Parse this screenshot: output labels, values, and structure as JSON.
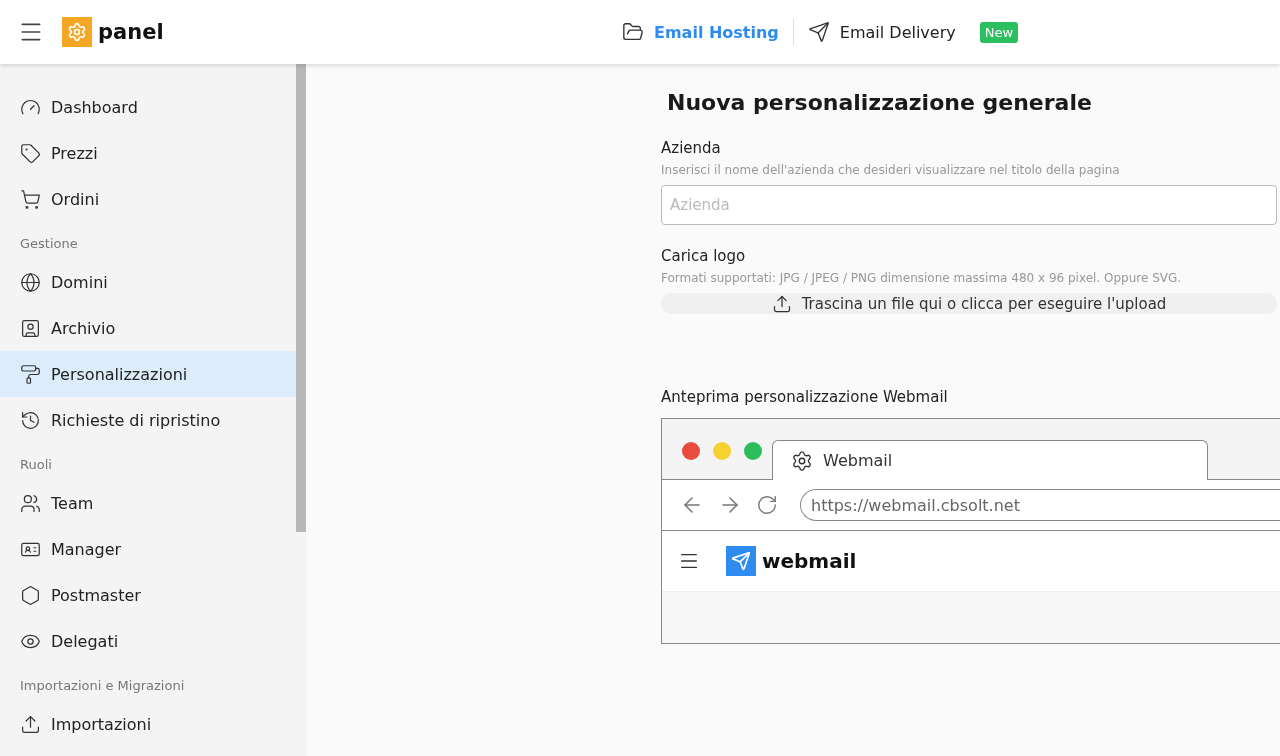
{
  "header": {
    "logo": "panel",
    "nav": [
      {
        "label": "Email Hosting",
        "selected": true
      },
      {
        "label": "Email Delivery",
        "selected": false,
        "badge": "New"
      }
    ]
  },
  "sidebar": {
    "items": [
      {
        "kind": "item",
        "label": "Dashboard",
        "selected": false
      },
      {
        "kind": "item",
        "label": "Prezzi",
        "selected": false
      },
      {
        "kind": "item",
        "label": "Ordini",
        "selected": false
      },
      {
        "kind": "section",
        "label": "Gestione"
      },
      {
        "kind": "item",
        "label": "Domini",
        "selected": false
      },
      {
        "kind": "item",
        "label": "Archivio",
        "selected": false
      },
      {
        "kind": "item",
        "label": "Personalizzazioni",
        "selected": true
      },
      {
        "kind": "item",
        "label": "Richieste di ripristino",
        "selected": false
      },
      {
        "kind": "section",
        "label": "Ruoli"
      },
      {
        "kind": "item",
        "label": "Team",
        "selected": false
      },
      {
        "kind": "item",
        "label": "Manager",
        "selected": false
      },
      {
        "kind": "item",
        "label": "Postmaster",
        "selected": false
      },
      {
        "kind": "item",
        "label": "Delegati",
        "selected": false
      },
      {
        "kind": "section",
        "label": "Importazioni e Migrazioni"
      },
      {
        "kind": "item",
        "label": "Importazioni",
        "selected": false
      }
    ]
  },
  "form": {
    "title": "Nuova personalizzazione generale",
    "company": {
      "label": "Azienda",
      "hint": "Inserisci il nome dell'azienda che desideri visualizzare nel titolo della pagina",
      "placeholder": "Azienda"
    },
    "logo": {
      "label": "Carica logo",
      "hint": "Formati supportati: JPG / JPEG / PNG dimensione massima 480 x 96 pixel. Oppure SVG.",
      "upload": "Trascina un file qui o clicca per eseguire l'upload"
    }
  },
  "preview": {
    "label": "Anteprima personalizzazione Webmail",
    "tab": "Webmail",
    "url": "https://webmail.cbsolt.net",
    "brand": "webmail"
  }
}
